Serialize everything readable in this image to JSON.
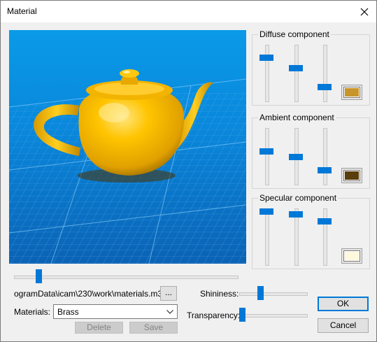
{
  "window": {
    "title": "Material"
  },
  "diffuse": {
    "label": "Diffuse component",
    "color": "#c8952a",
    "levels": [
      0.78,
      0.56,
      0.18
    ]
  },
  "ambient": {
    "label": "Ambient component",
    "color": "#5a3d0c",
    "levels": [
      0.56,
      0.45,
      0.18
    ]
  },
  "specular": {
    "label": "Specular component",
    "color": "#fff8dc",
    "levels": [
      0.97,
      0.92,
      0.77
    ]
  },
  "viewport": {
    "background_top": "#0a96e8",
    "background_bottom": "#0b5aa8",
    "object_color": "#f2b000",
    "object": "teapot"
  },
  "zoom_slider": {
    "level": 0.1
  },
  "file": {
    "path": "ogramData\\icam\\230\\work\\materials.m3d",
    "browse_label": "..."
  },
  "materials": {
    "label": "Materials:",
    "selected": "Brass",
    "delete_label": "Delete",
    "save_label": "Save"
  },
  "shininess": {
    "label": "Shininess:",
    "level": 0.3
  },
  "transparency": {
    "label": "Transparency:",
    "level": 0.0
  },
  "buttons": {
    "ok": "OK",
    "cancel": "Cancel"
  },
  "colors": {
    "accent": "#0078d7"
  }
}
